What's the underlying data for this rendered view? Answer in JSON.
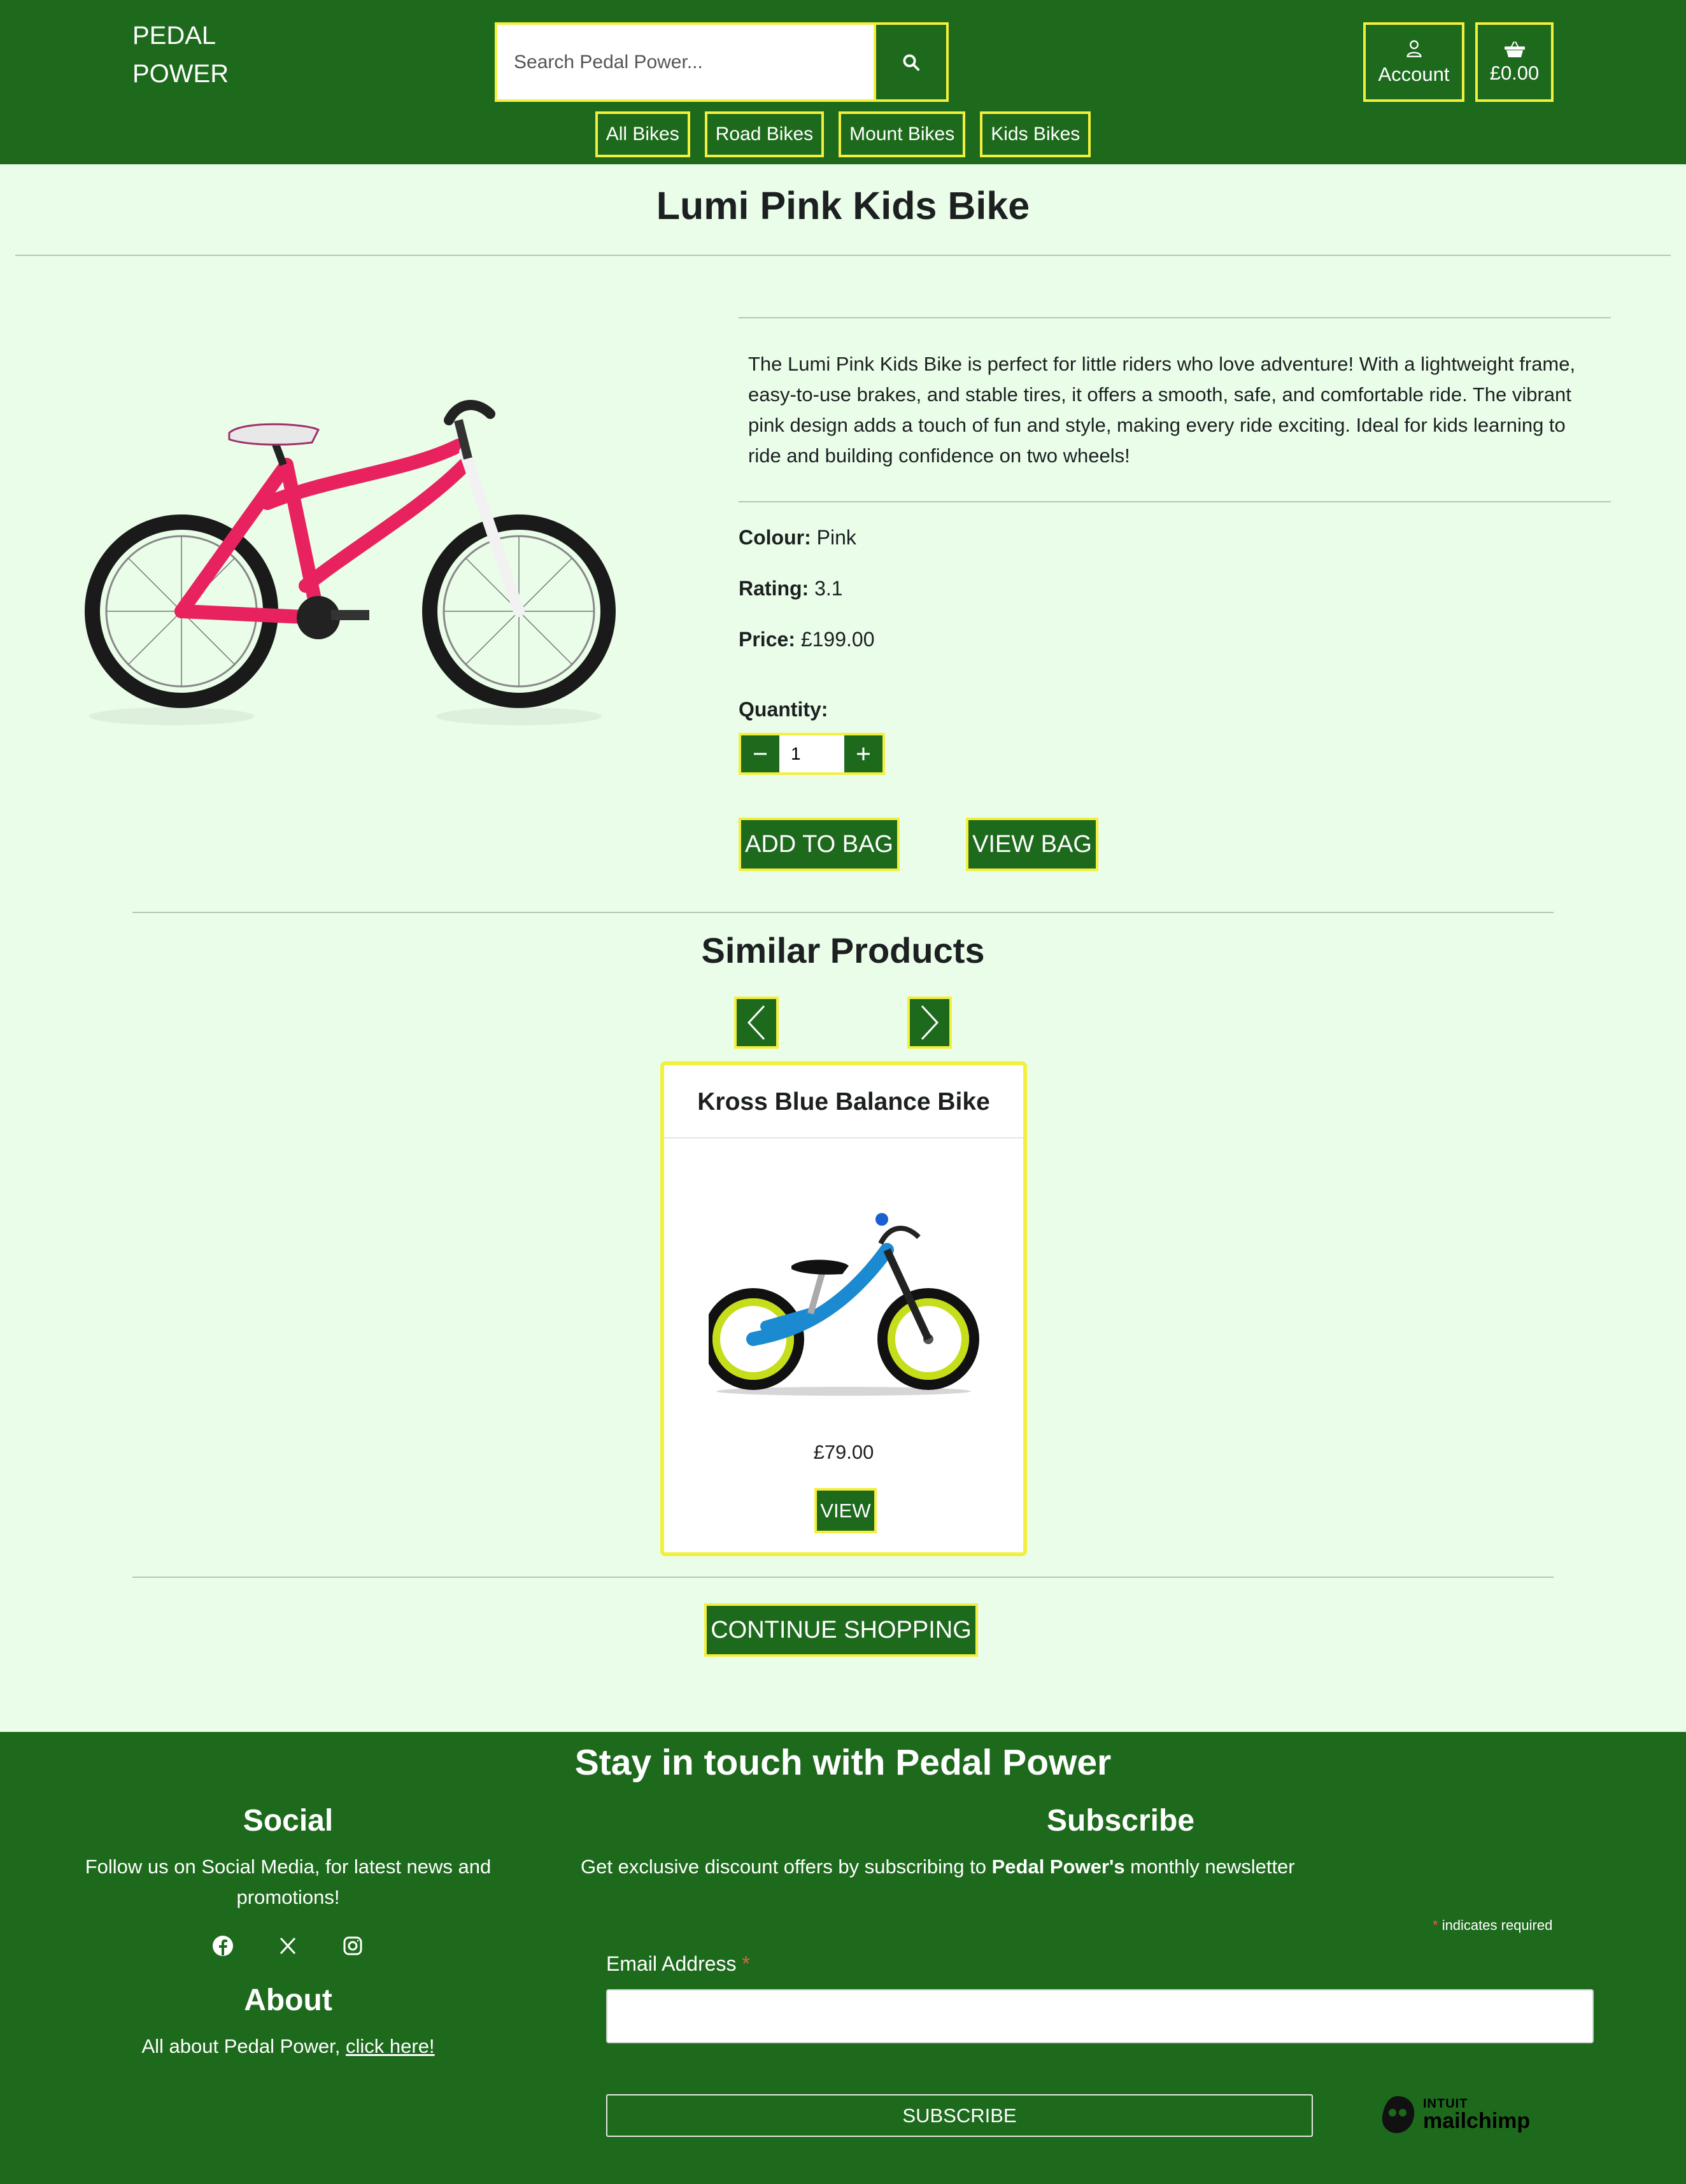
{
  "header": {
    "logo_line1": "PEDAL",
    "logo_line2": "POWER",
    "search_placeholder": "Search Pedal Power...",
    "account_label": "Account",
    "bag_total": "£0.00",
    "nav": [
      "All Bikes",
      "Road Bikes",
      "Mount Bikes",
      "Kids Bikes"
    ]
  },
  "product": {
    "title": "Lumi Pink Kids Bike",
    "description": "The Lumi Pink Kids Bike is perfect for little riders who love adventure! With a lightweight frame, easy-to-use brakes, and stable tires, it offers a smooth, safe, and comfortable ride. The vibrant pink design adds a touch of fun and style, making every ride exciting. Ideal for kids learning to ride and building confidence on two wheels!",
    "colour_label": "Colour:",
    "colour": "Pink",
    "rating_label": "Rating:",
    "rating": "3.1",
    "price_label": "Price:",
    "price": "£199.00",
    "quantity_label": "Quantity:",
    "quantity": "1",
    "frame_color": "#e8225f",
    "add_to_bag": "ADD TO BAG",
    "view_bag": "VIEW BAG"
  },
  "similar": {
    "title": "Similar Products",
    "card": {
      "name": "Kross Blue Balance Bike",
      "price": "£79.00",
      "view": "VIEW"
    }
  },
  "continue_shopping": "CONTINUE SHOPPING",
  "footer": {
    "heading": "Stay in touch with Pedal Power",
    "social_title": "Social",
    "social_text": "Follow us on Social Media, for latest news and promotions!",
    "about_title": "About",
    "about_text": "All about Pedal Power, ",
    "about_link": "click here!",
    "subscribe_title": "Subscribe",
    "subscribe_text_1": "Get exclusive discount offers by subscribing to ",
    "subscribe_brand": "Pedal Power's",
    "subscribe_text_2": " monthly newsletter",
    "required_note": "indicates required",
    "required_mark": "*",
    "email_label": "Email Address",
    "subscribe_button": "SUBSCRIBE",
    "mailchimp_intuit": "INTUIT",
    "mailchimp_name": "mailchimp"
  },
  "colors": {
    "brand_green": "#1d6a1d",
    "accent_yellow": "#f3ef3d",
    "page_background": "#eafde9"
  }
}
